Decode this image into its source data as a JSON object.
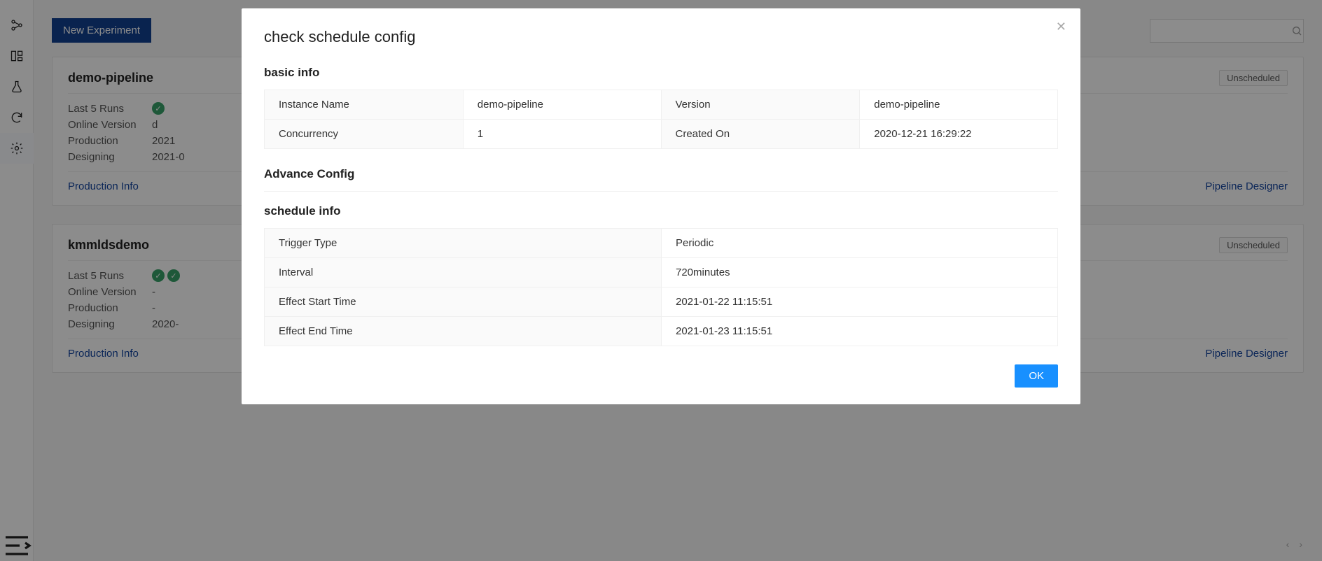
{
  "topbar": {
    "new_experiment_label": "New Experiment",
    "search_placeholder": ""
  },
  "cards": [
    {
      "title": "demo-pipeline",
      "badge": "Unscheduled",
      "last5_label": "Last 5 Runs",
      "online_version_label": "Online Version",
      "online_version_value": "d",
      "production_label": "Production",
      "production_value": "2021",
      "designing_label": "Designing",
      "designing_value": "2021-0",
      "link_left": "Production Info",
      "link_right": "Pipeline Designer",
      "run_dots": 1
    },
    {
      "title": "kmmldsdemo",
      "badge": "Unscheduled",
      "last5_label": "Last 5 Runs",
      "online_version_label": "Online Version",
      "online_version_value": "-",
      "production_label": "Production",
      "production_value": "-",
      "designing_label": "Designing",
      "designing_value": "2020-",
      "link_left": "Production Info",
      "link_right": "Pipeline Designer",
      "run_dots": 2
    }
  ],
  "modal": {
    "title": "check schedule config",
    "section_basic": "basic info",
    "section_advance": "Advance Config",
    "section_schedule": "schedule info",
    "ok_label": "OK",
    "basic": {
      "instance_name_label": "Instance Name",
      "instance_name_value": "demo-pipeline",
      "version_label": "Version",
      "version_value": "demo-pipeline",
      "concurrency_label": "Concurrency",
      "concurrency_value": "1",
      "created_on_label": "Created On",
      "created_on_value": "2020-12-21 16:29:22"
    },
    "schedule": {
      "trigger_type_label": "Trigger Type",
      "trigger_type_value": "Periodic",
      "interval_label": "Interval",
      "interval_value": "720minutes",
      "effect_start_label": "Effect Start Time",
      "effect_start_value": "2021-01-22 11:15:51",
      "effect_end_label": "Effect End Time",
      "effect_end_value": "2021-01-23 11:15:51"
    }
  }
}
